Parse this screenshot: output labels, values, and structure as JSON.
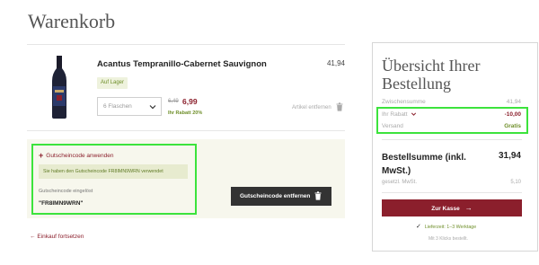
{
  "page": {
    "title": "Warenkorb"
  },
  "item": {
    "name": "Acantus Tempranillo-Cabernet Sauvignon",
    "price": "41,94",
    "stock": "Auf Lager",
    "quantity": "6 Flaschen",
    "old_price": "6,49",
    "new_price": "6,99",
    "discount": "Ihr Rabatt 20%",
    "remove": "Artikel entfernen"
  },
  "voucher": {
    "toggle_label": "Gutscheincode anwenden",
    "message": "Sie haben den Gutscheincode FR8IMN9WRN verwendet",
    "label": "Gutscheincode eingelöst",
    "code": "\"FR8IMN9WRN\"",
    "remove_button": "Gutscheincode entfernen"
  },
  "continue_link": "Einkauf fortsetzen",
  "summary": {
    "title": "Übersicht Ihrer Bestellung",
    "subtotal_label": "Zwischensumme",
    "subtotal_value": "41,94",
    "discount_label": "Ihr Rabatt",
    "discount_value": "-10,00",
    "shipping_label": "Versand",
    "shipping_value": "Gratis",
    "total_label": "Bestellsumme (inkl. MwSt.)",
    "total_value": "31,94",
    "vat_label": "gesetzl. MwSt.",
    "vat_value": "5,10",
    "checkout_button": "Zur Kasse",
    "delivery": "Lieferzeit: 1–3 Werktage",
    "clicks": "Mit 3 Klicks bestellt."
  },
  "colors": {
    "brand": "#8b1f2c",
    "success": "#6f8f2a",
    "highlight": "#3ce33c"
  }
}
